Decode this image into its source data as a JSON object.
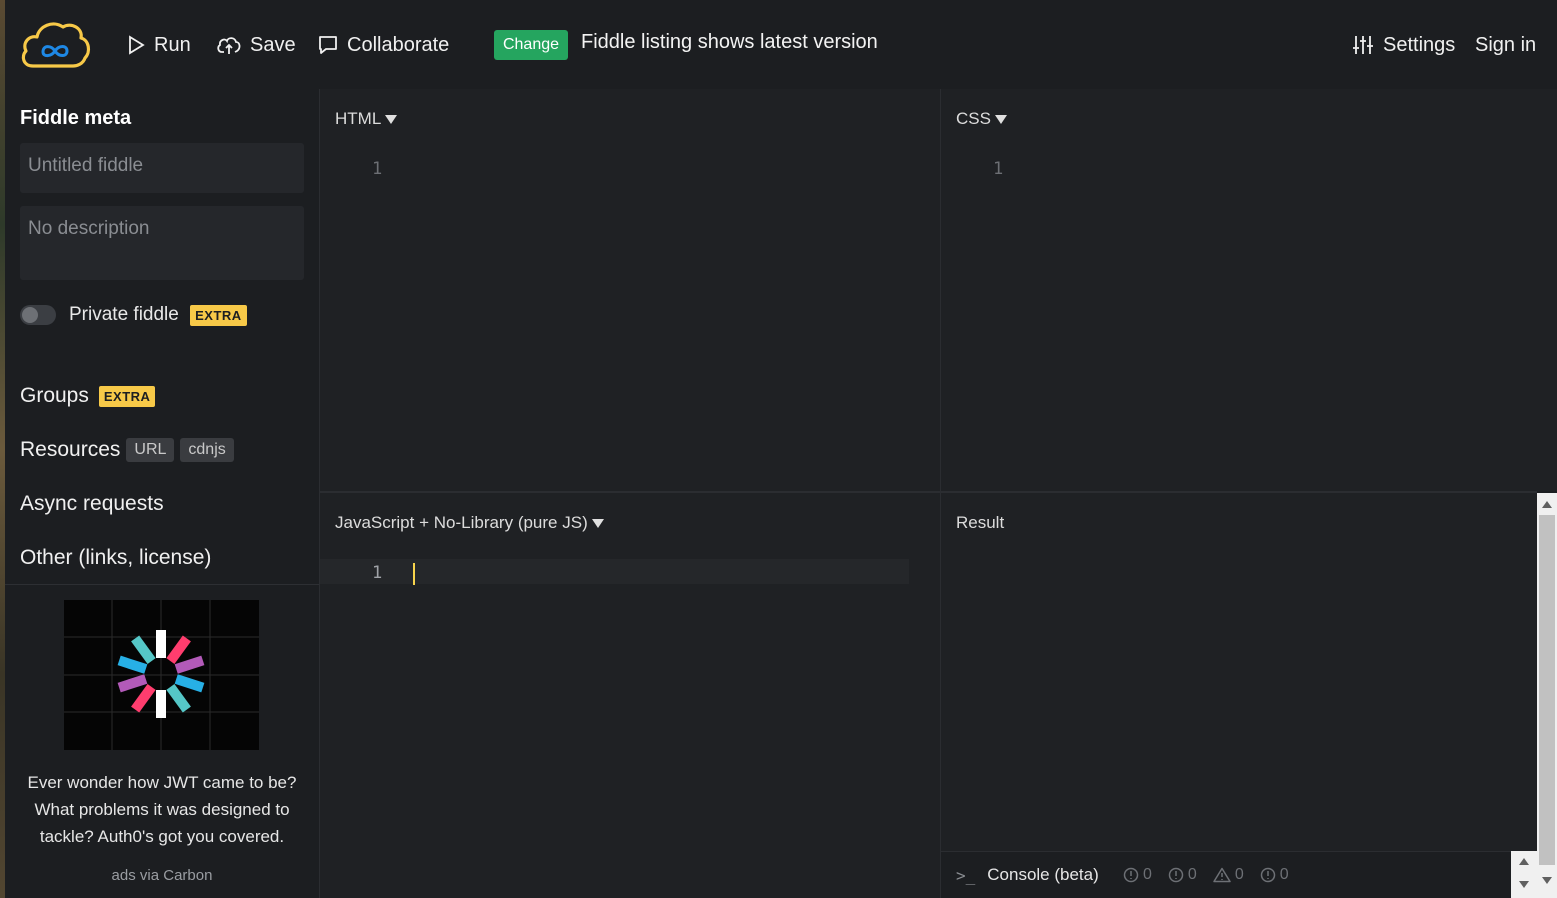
{
  "topbar": {
    "logo_icon": "cloud-infinity-logo",
    "run_label": "Run",
    "save_label": "Save",
    "collaborate_label": "Collaborate",
    "change_badge": "Change",
    "listing_text": "Fiddle listing shows latest version",
    "settings_label": "Settings",
    "signin_label": "Sign in"
  },
  "sidebar": {
    "title": "Fiddle meta",
    "title_placeholder": "Untitled fiddle",
    "description_placeholder": "No description",
    "private_label": "Private fiddle",
    "private_badge": "EXTRA",
    "private_enabled": false,
    "groups_label": "Groups",
    "groups_badge": "EXTRA",
    "resources_label": "Resources",
    "resources_tags": [
      "URL",
      "cdnjs"
    ],
    "async_label": "Async requests",
    "other_label": "Other (links, license)"
  },
  "ad": {
    "text": "Ever wonder how JWT came to be? What problems it was designed to tackle? Auth0's got you covered.",
    "via": "ads via Carbon"
  },
  "panels": {
    "html": {
      "label": "HTML",
      "line": "1"
    },
    "css": {
      "label": "CSS",
      "line": "1"
    },
    "js": {
      "label": "JavaScript + No-Library (pure JS)",
      "line": "1"
    },
    "result": {
      "label": "Result"
    }
  },
  "console": {
    "prompt": ">_",
    "label": "Console (beta)",
    "counts": [
      "0",
      "0",
      "0",
      "0"
    ]
  },
  "colors": {
    "background": "#1c1e21",
    "accent_green": "#25a55f",
    "extra_yellow": "#f7c948",
    "cursor_yellow": "#f7d44c"
  }
}
